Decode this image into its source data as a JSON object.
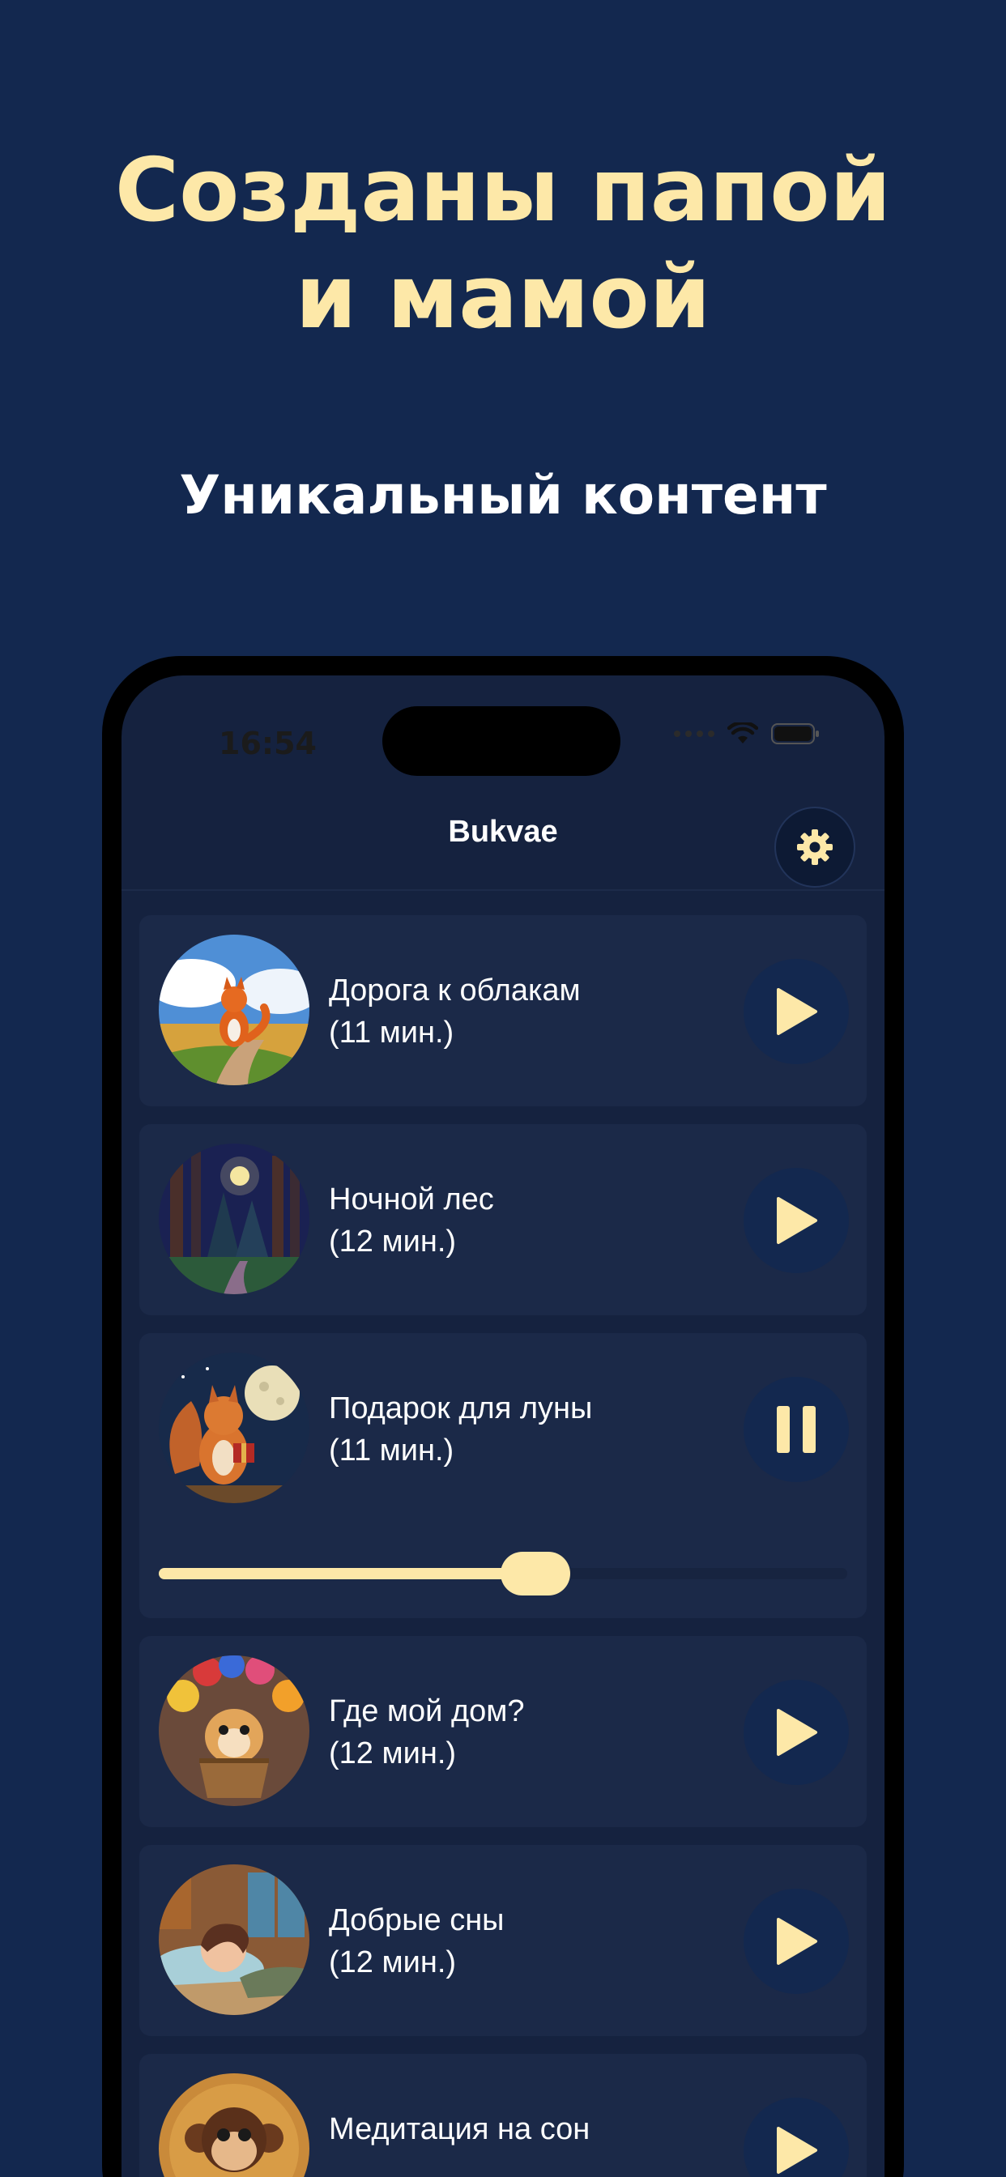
{
  "headline": {
    "line1": "Созданы папой",
    "line2": "и мамой"
  },
  "subheadline": "Уникальный контент",
  "status_bar": {
    "time": "16:54"
  },
  "app": {
    "title": "Bukvae",
    "settings_icon": "gear-icon"
  },
  "stories": [
    {
      "title": "Дорога к облакам",
      "duration": "(11 мин.)",
      "state": "play",
      "thumb": "fox-on-path"
    },
    {
      "title": "Ночной лес",
      "duration": "(12 мин.)",
      "state": "play",
      "thumb": "night-forest"
    },
    {
      "title": "Подарок для луны",
      "duration": "(11 мин.)",
      "state": "pause",
      "thumb": "squirrel-moon",
      "progress": 0.55
    },
    {
      "title": "Где мой дом?",
      "duration": "(12 мин.)",
      "state": "play",
      "thumb": "hamster-balloons"
    },
    {
      "title": "Добрые сны",
      "duration": "(12 мин.)",
      "state": "play",
      "thumb": "sleeping-girl"
    },
    {
      "title": "Медитация на сон",
      "duration": "",
      "state": "play",
      "thumb": "monkey"
    }
  ],
  "colors": {
    "background": "#13284f",
    "accent": "#fde8a8",
    "card": "#1b2948"
  }
}
